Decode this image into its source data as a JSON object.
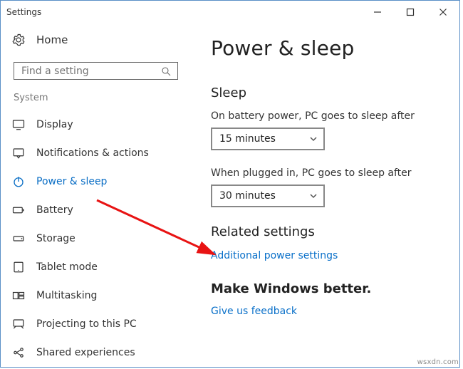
{
  "window": {
    "title": "Settings"
  },
  "home": {
    "label": "Home"
  },
  "search": {
    "placeholder": "Find a setting"
  },
  "section": {
    "label": "System"
  },
  "nav": {
    "display": "Display",
    "notifications": "Notifications & actions",
    "power_sleep": "Power & sleep",
    "battery": "Battery",
    "storage": "Storage",
    "tablet_mode": "Tablet mode",
    "multitasking": "Multitasking",
    "projecting": "Projecting to this PC",
    "shared": "Shared experiences"
  },
  "page": {
    "title": "Power & sleep",
    "sleep_heading": "Sleep",
    "battery_text": "On battery power, PC goes to sleep after",
    "battery_value": "15 minutes",
    "plugged_text": "When plugged in, PC goes to sleep after",
    "plugged_value": "30 minutes",
    "related_heading": "Related settings",
    "related_link": "Additional power settings",
    "better_heading": "Make Windows better.",
    "feedback_link": "Give us feedback"
  },
  "watermark": "wsxdn.com"
}
